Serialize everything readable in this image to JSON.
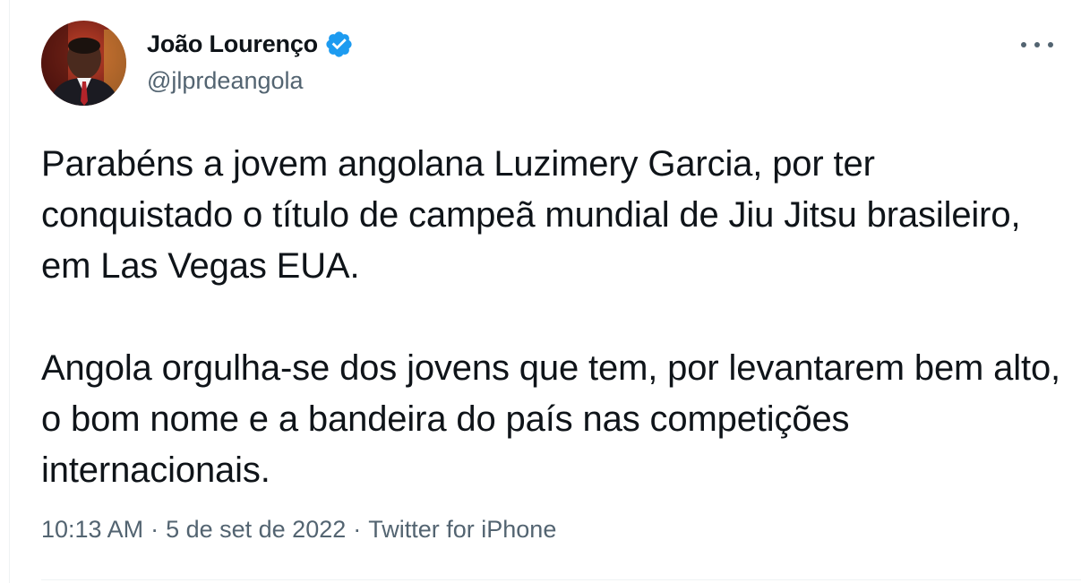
{
  "author": {
    "display_name": "João Lourenço",
    "handle": "@jlprdeangola",
    "verified": true,
    "avatar_icon": "profile-photo"
  },
  "tweet": {
    "paragraph_1": "Parabéns a jovem angolana Luzimery Garcia, por ter conquistado o título de campeã mundial de Jiu Jitsu brasileiro, em Las Vegas EUA.",
    "paragraph_2": "Angola orgulha-se dos jovens que tem, por levantarem bem alto, o bom nome e a bandeira do país nas competições internacionais.",
    "time": "10:13 AM",
    "date": "5 de set de 2022",
    "source": "Twitter for iPhone",
    "separator": "·"
  },
  "colors": {
    "text": "#0f1419",
    "secondary": "#536471",
    "verified": "#1d9bf0",
    "divider": "#eff3f4"
  },
  "icons": {
    "verified": "verified-badge-icon",
    "more": "more-options-icon"
  }
}
